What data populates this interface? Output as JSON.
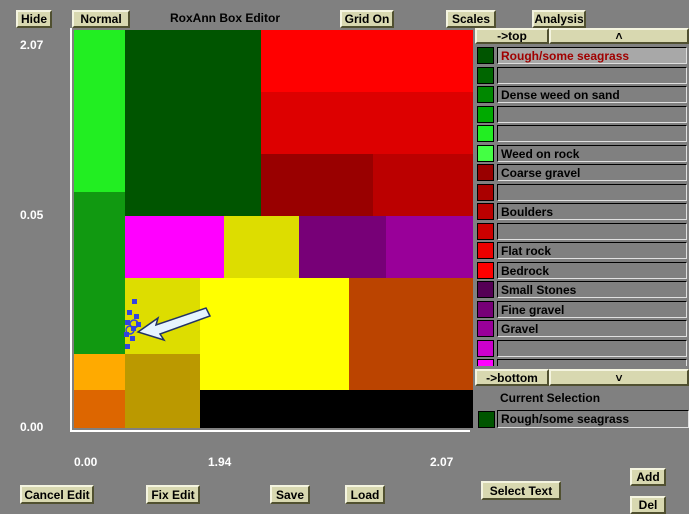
{
  "window": {
    "title": "RoxAnn Box Editor"
  },
  "toolbar": {
    "hide": "Hide",
    "normal": "Normal",
    "grid": "Grid On",
    "scales": "Scales",
    "analysis": "Analysis"
  },
  "axes": {
    "y_top": "2.07",
    "y_mid": "0.05",
    "y_bottom": "0.00",
    "x_left": "0.00",
    "x_mid": "1.94",
    "x_right": "2.07"
  },
  "plot_colors": {
    "bright_green": "#22ee22",
    "mid_green": "#119911",
    "dark_green": "#005500",
    "red": "#ff0000",
    "red2": "#dd0000",
    "dark_red": "#990000",
    "red3": "#bb0000",
    "magenta": "#ff00ff",
    "yellow_olive": "#dddd00",
    "purple": "#770077",
    "purple2": "#990099",
    "yellow2": "#dddd00",
    "yellow": "#ffff00",
    "brown_orange": "#bb4400",
    "orange": "#ffaa00",
    "dark_orange": "#dd6600",
    "tan": "#bb9900",
    "black": "#000000"
  },
  "list": {
    "scroll_top": "->top",
    "scroll_bottom": "->bottom",
    "up_arrow": "˄",
    "down_arrow": "˅",
    "items": [
      {
        "label": "Rough/some seagrass",
        "color": "#005500",
        "selected": true
      },
      {
        "label": "",
        "color": "#006600"
      },
      {
        "label": "Dense weed on sand",
        "color": "#008800"
      },
      {
        "label": "",
        "color": "#00aa00"
      },
      {
        "label": "",
        "color": "#22ee22"
      },
      {
        "label": "Weed on rock",
        "color": "#44ff44"
      },
      {
        "label": "Coarse gravel",
        "color": "#990000"
      },
      {
        "label": "",
        "color": "#aa0000"
      },
      {
        "label": "Boulders",
        "color": "#bb0000"
      },
      {
        "label": "",
        "color": "#cc0000"
      },
      {
        "label": "Flat rock",
        "color": "#ee0000"
      },
      {
        "label": "Bedrock",
        "color": "#ff0000"
      },
      {
        "label": "Small Stones",
        "color": "#550055"
      },
      {
        "label": "Fine gravel",
        "color": "#770077"
      },
      {
        "label": "Gravel",
        "color": "#990099"
      },
      {
        "label": "",
        "color": "#cc00cc"
      },
      {
        "label": "",
        "color": "#ff00ff"
      }
    ]
  },
  "current_selection": {
    "heading": "Current Selection",
    "label": "Rough/some seagrass",
    "color": "#005500"
  },
  "bottom": {
    "cancel_edit": "Cancel Edit",
    "fix_edit": "Fix Edit",
    "save": "Save",
    "load": "Load",
    "select_text": "Select Text",
    "add": "Add",
    "del": "Del"
  }
}
